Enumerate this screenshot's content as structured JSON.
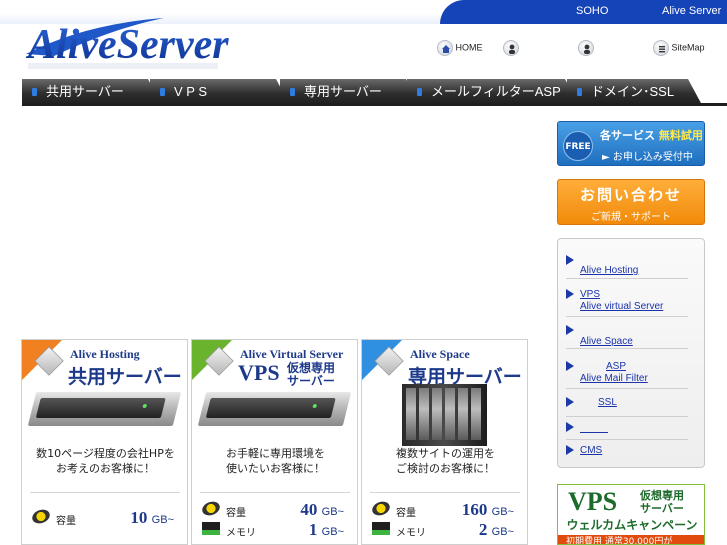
{
  "topbar": {
    "links": [
      "SOHO",
      "Alive Server"
    ]
  },
  "logo": {
    "text": "AliveServer"
  },
  "header_nav": {
    "home": "HOME",
    "sitemap": "SiteMap"
  },
  "menu": {
    "items": [
      "共用サーバー",
      "V P S",
      "専用サーバー",
      "メールフィルターASP",
      "ドメイン･SSL"
    ]
  },
  "banners": {
    "free": {
      "badge": "FREE",
      "line1_a": "各サービス",
      "line1_b": "無料試用",
      "line2": "► お申し込み受付中"
    },
    "contact": {
      "title": "お問い合わせ",
      "sub": "ご新規・サポート"
    },
    "vps": {
      "big": "VPS",
      "small1": "仮想専用",
      "small2": "サーバー",
      "campaign": "ウェルカムキャンペーン",
      "strip": "初期費用 通常30,000円が"
    }
  },
  "sidebar": {
    "items": [
      {
        "label": "Alive Hosting"
      },
      {
        "label1": "VPS",
        "label2": "Alive virtual Server"
      },
      {
        "label": "Alive Space"
      },
      {
        "label1": "ASP",
        "label2": "Alive Mail Filter"
      },
      {
        "label": "SSL"
      },
      {
        "label": ""
      },
      {
        "label": "CMS"
      }
    ]
  },
  "cards": [
    {
      "name": "Alive Hosting",
      "category": "共用サーバー",
      "desc1": "数10ページ程度の会社HPを",
      "desc2": "お考えのお客様に！",
      "cap_label": "容量",
      "cap_value": "10",
      "cap_unit": "GB~",
      "color": "#f08020"
    },
    {
      "name": "Alive Virtual Server",
      "category_big": "VPS",
      "category_small1": "仮想専用",
      "category_small2": "サーバー",
      "desc1": "お手軽に専用環境を",
      "desc2": "使いたいお客様に！",
      "cap_label": "容量",
      "cap_value": "40",
      "cap_unit": "GB~",
      "mem_label": "メモリ",
      "mem_value": "1",
      "mem_unit": "GB~",
      "color": "#6ab42d"
    },
    {
      "name": "Alive Space",
      "category": "専用サーバー",
      "desc1": "複数サイトの運用を",
      "desc2": "ご検討のお客様に！",
      "cap_label": "容量",
      "cap_value": "160",
      "cap_unit": "GB~",
      "mem_label": "メモリ",
      "mem_value": "2",
      "mem_unit": "GB~",
      "color": "#2f8fe0"
    }
  ]
}
